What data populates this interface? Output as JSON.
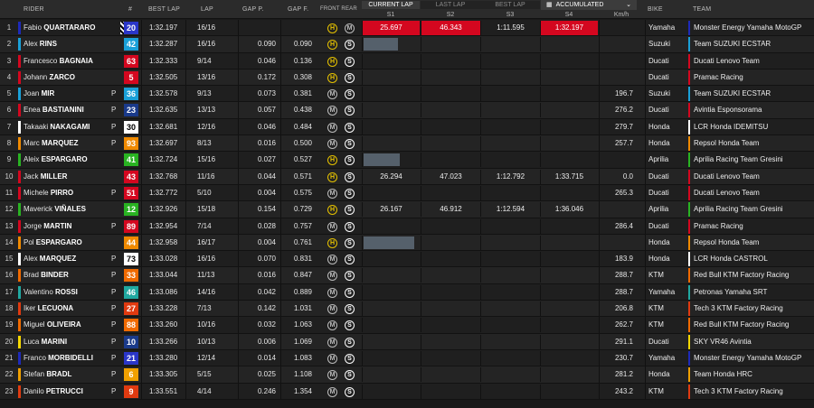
{
  "header": {
    "rider": "RIDER",
    "num": "#",
    "best_lap": "BEST LAP",
    "lap": "LAP",
    "gap_p": "GAP P.",
    "gap_f": "GAP F.",
    "front_rear": "FRONT REAR",
    "kmh": "Km/h",
    "bike": "BIKE",
    "team": "TEAM",
    "current_lap": "CURRENT LAP",
    "last_lap": "LAST LAP",
    "best_lap_toggle": "BEST LAP",
    "accumulated": "ACCUMULATED",
    "s1": "S1",
    "s2": "S2",
    "s3": "S3",
    "s4": "S4"
  },
  "colors": {
    "yamaha_factory": "#1e2ab8",
    "suzuki": "#1aa0d8",
    "ducati": "#d4071f",
    "pramac": "#d4071f",
    "honda_repsol": "#f08a00",
    "aprilia": "#29b322",
    "ktm": "#f06a00",
    "petronas": "#20a8a0",
    "avintia": "#d4071f",
    "lcr_castrol": "#ffffff",
    "lcr_idemitsu": "#ffffff",
    "tech3": "#e03a10",
    "vr46": "#f5d800",
    "honda_hrc": "#f0a000"
  },
  "rows": [
    {
      "pos": "1",
      "first": "Fabio",
      "last": "QUARTARARO",
      "pit": "",
      "num": "20",
      "numbg": "#2a36c8",
      "numfg": "#fff",
      "flag": true,
      "best": "1:32.197",
      "lap": "16/16",
      "gp": "",
      "gf": "",
      "front": "H",
      "rear": "M",
      "s1": "25.697",
      "s2": "46.343",
      "s3": "1:11.595",
      "s4": "1:32.197",
      "s1c": "red",
      "s2c": "red",
      "s3c": "",
      "s4c": "red",
      "bar": 0,
      "kmh": "",
      "bike": "Yamaha",
      "team": "Monster Energy Yamaha MotoGP",
      "tc": "#1e2ab8"
    },
    {
      "pos": "2",
      "first": "Alex",
      "last": "RINS",
      "pit": "",
      "num": "42",
      "numbg": "#1aa0d8",
      "numfg": "#fff",
      "flag": false,
      "best": "1:32.287",
      "lap": "16/16",
      "gp": "0.090",
      "gf": "0.090",
      "front": "H",
      "rear": "S",
      "s1": "",
      "s2": "",
      "s3": "",
      "s4": "",
      "s1c": "",
      "s2c": "",
      "s3c": "",
      "s4c": "",
      "bar": 38,
      "kmh": "",
      "bike": "Suzuki",
      "team": "Team SUZUKI ECSTAR",
      "tc": "#1aa0d8"
    },
    {
      "pos": "3",
      "first": "Francesco",
      "last": "BAGNAIA",
      "pit": "",
      "num": "63",
      "numbg": "#d4071f",
      "numfg": "#fff",
      "flag": false,
      "best": "1:32.333",
      "lap": "9/14",
      "gp": "0.046",
      "gf": "0.136",
      "front": "H",
      "rear": "S",
      "s1": "",
      "s2": "",
      "s3": "",
      "s4": "",
      "s1c": "",
      "s2c": "",
      "s3c": "",
      "s4c": "",
      "bar": 0,
      "kmh": "",
      "bike": "Ducati",
      "team": "Ducati Lenovo Team",
      "tc": "#d4071f"
    },
    {
      "pos": "4",
      "first": "Johann",
      "last": "ZARCO",
      "pit": "",
      "num": "5",
      "numbg": "#d4071f",
      "numfg": "#fff",
      "flag": false,
      "best": "1:32.505",
      "lap": "13/16",
      "gp": "0.172",
      "gf": "0.308",
      "front": "H",
      "rear": "S",
      "s1": "",
      "s2": "",
      "s3": "",
      "s4": "",
      "s1c": "",
      "s2c": "",
      "s3c": "",
      "s4c": "",
      "bar": 0,
      "kmh": "",
      "bike": "Ducati",
      "team": "Pramac Racing",
      "tc": "#d4071f"
    },
    {
      "pos": "5",
      "first": "Joan",
      "last": "MIR",
      "pit": "P",
      "num": "36",
      "numbg": "#1aa0d8",
      "numfg": "#fff",
      "flag": false,
      "best": "1:32.578",
      "lap": "9/13",
      "gp": "0.073",
      "gf": "0.381",
      "front": "M",
      "rear": "S",
      "s1": "",
      "s2": "",
      "s3": "",
      "s4": "",
      "s1c": "",
      "s2c": "",
      "s3c": "",
      "s4c": "",
      "bar": 0,
      "kmh": "196.7",
      "bike": "Suzuki",
      "team": "Team SUZUKI ECSTAR",
      "tc": "#1aa0d8"
    },
    {
      "pos": "6",
      "first": "Enea",
      "last": "BASTIANINI",
      "pit": "P",
      "num": "23",
      "numbg": "#1a3a8a",
      "numfg": "#fff",
      "flag": false,
      "best": "1:32.635",
      "lap": "13/13",
      "gp": "0.057",
      "gf": "0.438",
      "front": "M",
      "rear": "S",
      "s1": "",
      "s2": "",
      "s3": "",
      "s4": "",
      "s1c": "",
      "s2c": "",
      "s3c": "",
      "s4c": "",
      "bar": 0,
      "kmh": "276.2",
      "bike": "Ducati",
      "team": "Avintia Esponsorama",
      "tc": "#d4071f"
    },
    {
      "pos": "7",
      "first": "Takaaki",
      "last": "NAKAGAMI",
      "pit": "P",
      "num": "30",
      "numbg": "#ffffff",
      "numfg": "#000",
      "flag": false,
      "best": "1:32.681",
      "lap": "12/16",
      "gp": "0.046",
      "gf": "0.484",
      "front": "M",
      "rear": "S",
      "s1": "",
      "s2": "",
      "s3": "",
      "s4": "",
      "s1c": "",
      "s2c": "",
      "s3c": "",
      "s4c": "",
      "bar": 0,
      "kmh": "279.7",
      "bike": "Honda",
      "team": "LCR Honda IDEMITSU",
      "tc": "#ffffff"
    },
    {
      "pos": "8",
      "first": "Marc",
      "last": "MARQUEZ",
      "pit": "P",
      "num": "93",
      "numbg": "#f08a00",
      "numfg": "#fff",
      "flag": false,
      "best": "1:32.697",
      "lap": "8/13",
      "gp": "0.016",
      "gf": "0.500",
      "front": "M",
      "rear": "S",
      "s1": "",
      "s2": "",
      "s3": "",
      "s4": "",
      "s1c": "",
      "s2c": "",
      "s3c": "",
      "s4c": "",
      "bar": 0,
      "kmh": "257.7",
      "bike": "Honda",
      "team": "Repsol Honda Team",
      "tc": "#f08a00"
    },
    {
      "pos": "9",
      "first": "Aleix",
      "last": "ESPARGARO",
      "pit": "",
      "num": "41",
      "numbg": "#29b322",
      "numfg": "#fff",
      "flag": false,
      "best": "1:32.724",
      "lap": "15/16",
      "gp": "0.027",
      "gf": "0.527",
      "front": "H",
      "rear": "S",
      "s1": "",
      "s2": "",
      "s3": "",
      "s4": "",
      "s1c": "",
      "s2c": "",
      "s3c": "",
      "s4c": "",
      "bar": 40,
      "kmh": "",
      "bike": "Aprilia",
      "team": "Aprilia Racing Team Gresini",
      "tc": "#29b322"
    },
    {
      "pos": "10",
      "first": "Jack",
      "last": "MILLER",
      "pit": "",
      "num": "43",
      "numbg": "#d4071f",
      "numfg": "#fff",
      "flag": false,
      "best": "1:32.768",
      "lap": "11/16",
      "gp": "0.044",
      "gf": "0.571",
      "front": "H",
      "rear": "S",
      "s1": "26.294",
      "s2": "47.023",
      "s3": "1:12.792",
      "s4": "1:33.715",
      "s1c": "",
      "s2c": "",
      "s3c": "",
      "s4c": "",
      "bar": 0,
      "kmh": "0.0",
      "bike": "Ducati",
      "team": "Ducati Lenovo Team",
      "tc": "#d4071f"
    },
    {
      "pos": "11",
      "first": "Michele",
      "last": "PIRRO",
      "pit": "P",
      "num": "51",
      "numbg": "#d4071f",
      "numfg": "#fff",
      "flag": false,
      "best": "1:32.772",
      "lap": "5/10",
      "gp": "0.004",
      "gf": "0.575",
      "front": "M",
      "rear": "S",
      "s1": "",
      "s2": "",
      "s3": "",
      "s4": "",
      "s1c": "",
      "s2c": "",
      "s3c": "",
      "s4c": "",
      "bar": 0,
      "kmh": "265.3",
      "bike": "Ducati",
      "team": "Ducati Lenovo Team",
      "tc": "#d4071f"
    },
    {
      "pos": "12",
      "first": "Maverick",
      "last": "VIÑALES",
      "pit": "",
      "num": "12",
      "numbg": "#29b322",
      "numfg": "#fff",
      "flag": false,
      "best": "1:32.926",
      "lap": "15/18",
      "gp": "0.154",
      "gf": "0.729",
      "front": "H",
      "rear": "S",
      "s1": "26.167",
      "s2": "46.912",
      "s3": "1:12.594",
      "s4": "1:36.046",
      "s1c": "",
      "s2c": "",
      "s3c": "",
      "s4c": "",
      "bar": 0,
      "kmh": "",
      "bike": "Aprilia",
      "team": "Aprilia Racing Team Gresini",
      "tc": "#29b322"
    },
    {
      "pos": "13",
      "first": "Jorge",
      "last": "MARTIN",
      "pit": "P",
      "num": "89",
      "numbg": "#d4071f",
      "numfg": "#fff",
      "flag": false,
      "best": "1:32.954",
      "lap": "7/14",
      "gp": "0.028",
      "gf": "0.757",
      "front": "M",
      "rear": "S",
      "s1": "",
      "s2": "",
      "s3": "",
      "s4": "",
      "s1c": "",
      "s2c": "",
      "s3c": "",
      "s4c": "",
      "bar": 0,
      "kmh": "286.4",
      "bike": "Ducati",
      "team": "Pramac Racing",
      "tc": "#d4071f"
    },
    {
      "pos": "14",
      "first": "Pol",
      "last": "ESPARGARO",
      "pit": "",
      "num": "44",
      "numbg": "#f08a00",
      "numfg": "#fff",
      "flag": false,
      "best": "1:32.958",
      "lap": "16/17",
      "gp": "0.004",
      "gf": "0.761",
      "front": "H",
      "rear": "S",
      "s1": "",
      "s2": "",
      "s3": "",
      "s4": "",
      "s1c": "",
      "s2c": "",
      "s3c": "",
      "s4c": "",
      "bar": 56,
      "kmh": "",
      "bike": "Honda",
      "team": "Repsol Honda Team",
      "tc": "#f08a00"
    },
    {
      "pos": "15",
      "first": "Alex",
      "last": "MARQUEZ",
      "pit": "P",
      "num": "73",
      "numbg": "#ffffff",
      "numfg": "#000",
      "flag": false,
      "best": "1:33.028",
      "lap": "16/16",
      "gp": "0.070",
      "gf": "0.831",
      "front": "M",
      "rear": "S",
      "s1": "",
      "s2": "",
      "s3": "",
      "s4": "",
      "s1c": "",
      "s2c": "",
      "s3c": "",
      "s4c": "",
      "bar": 0,
      "kmh": "183.9",
      "bike": "Honda",
      "team": "LCR Honda CASTROL",
      "tc": "#ffffff"
    },
    {
      "pos": "16",
      "first": "Brad",
      "last": "BINDER",
      "pit": "P",
      "num": "33",
      "numbg": "#f06a00",
      "numfg": "#fff",
      "flag": false,
      "best": "1:33.044",
      "lap": "11/13",
      "gp": "0.016",
      "gf": "0.847",
      "front": "M",
      "rear": "S",
      "s1": "",
      "s2": "",
      "s3": "",
      "s4": "",
      "s1c": "",
      "s2c": "",
      "s3c": "",
      "s4c": "",
      "bar": 0,
      "kmh": "288.7",
      "bike": "KTM",
      "team": "Red Bull KTM Factory Racing",
      "tc": "#f06a00"
    },
    {
      "pos": "17",
      "first": "Valentino",
      "last": "ROSSI",
      "pit": "P",
      "num": "46",
      "numbg": "#20a8a0",
      "numfg": "#fff",
      "flag": false,
      "best": "1:33.086",
      "lap": "14/16",
      "gp": "0.042",
      "gf": "0.889",
      "front": "M",
      "rear": "S",
      "s1": "",
      "s2": "",
      "s3": "",
      "s4": "",
      "s1c": "",
      "s2c": "",
      "s3c": "",
      "s4c": "",
      "bar": 0,
      "kmh": "288.7",
      "bike": "Yamaha",
      "team": "Petronas Yamaha SRT",
      "tc": "#20a8a0"
    },
    {
      "pos": "18",
      "first": "Iker",
      "last": "LECUONA",
      "pit": "P",
      "num": "27",
      "numbg": "#e03a10",
      "numfg": "#fff",
      "flag": false,
      "best": "1:33.228",
      "lap": "7/13",
      "gp": "0.142",
      "gf": "1.031",
      "front": "M",
      "rear": "S",
      "s1": "",
      "s2": "",
      "s3": "",
      "s4": "",
      "s1c": "",
      "s2c": "",
      "s3c": "",
      "s4c": "",
      "bar": 0,
      "kmh": "206.8",
      "bike": "KTM",
      "team": "Tech 3 KTM Factory Racing",
      "tc": "#e03a10"
    },
    {
      "pos": "19",
      "first": "Miguel",
      "last": "OLIVEIRA",
      "pit": "P",
      "num": "88",
      "numbg": "#f06a00",
      "numfg": "#fff",
      "flag": false,
      "best": "1:33.260",
      "lap": "10/16",
      "gp": "0.032",
      "gf": "1.063",
      "front": "M",
      "rear": "S",
      "s1": "",
      "s2": "",
      "s3": "",
      "s4": "",
      "s1c": "",
      "s2c": "",
      "s3c": "",
      "s4c": "",
      "bar": 0,
      "kmh": "262.7",
      "bike": "KTM",
      "team": "Red Bull KTM Factory Racing",
      "tc": "#f06a00"
    },
    {
      "pos": "20",
      "first": "Luca",
      "last": "MARINI",
      "pit": "P",
      "num": "10",
      "numbg": "#1a3a8a",
      "numfg": "#fff",
      "flag": false,
      "best": "1:33.266",
      "lap": "10/13",
      "gp": "0.006",
      "gf": "1.069",
      "front": "M",
      "rear": "S",
      "s1": "",
      "s2": "",
      "s3": "",
      "s4": "",
      "s1c": "",
      "s2c": "",
      "s3c": "",
      "s4c": "",
      "bar": 0,
      "kmh": "291.1",
      "bike": "Ducati",
      "team": "SKY VR46 Avintia",
      "tc": "#f5d800"
    },
    {
      "pos": "21",
      "first": "Franco",
      "last": "MORBIDELLI",
      "pit": "P",
      "num": "21",
      "numbg": "#2a36c8",
      "numfg": "#fff",
      "flag": false,
      "best": "1:33.280",
      "lap": "12/14",
      "gp": "0.014",
      "gf": "1.083",
      "front": "M",
      "rear": "S",
      "s1": "",
      "s2": "",
      "s3": "",
      "s4": "",
      "s1c": "",
      "s2c": "",
      "s3c": "",
      "s4c": "",
      "bar": 0,
      "kmh": "230.7",
      "bike": "Yamaha",
      "team": "Monster Energy Yamaha MotoGP",
      "tc": "#1e2ab8"
    },
    {
      "pos": "22",
      "first": "Stefan",
      "last": "BRADL",
      "pit": "P",
      "num": "6",
      "numbg": "#f0a000",
      "numfg": "#fff",
      "flag": false,
      "best": "1:33.305",
      "lap": "5/15",
      "gp": "0.025",
      "gf": "1.108",
      "front": "M",
      "rear": "S",
      "s1": "",
      "s2": "",
      "s3": "",
      "s4": "",
      "s1c": "",
      "s2c": "",
      "s3c": "",
      "s4c": "",
      "bar": 0,
      "kmh": "281.2",
      "bike": "Honda",
      "team": "Team Honda HRC",
      "tc": "#f0a000"
    },
    {
      "pos": "23",
      "first": "Danilo",
      "last": "PETRUCCI",
      "pit": "P",
      "num": "9",
      "numbg": "#e03a10",
      "numfg": "#fff",
      "flag": false,
      "best": "1:33.551",
      "lap": "4/14",
      "gp": "0.246",
      "gf": "1.354",
      "front": "M",
      "rear": "S",
      "s1": "",
      "s2": "",
      "s3": "",
      "s4": "",
      "s1c": "",
      "s2c": "",
      "s3c": "",
      "s4c": "",
      "bar": 0,
      "kmh": "243.2",
      "bike": "KTM",
      "team": "Tech 3 KTM Factory Racing",
      "tc": "#e03a10"
    }
  ]
}
